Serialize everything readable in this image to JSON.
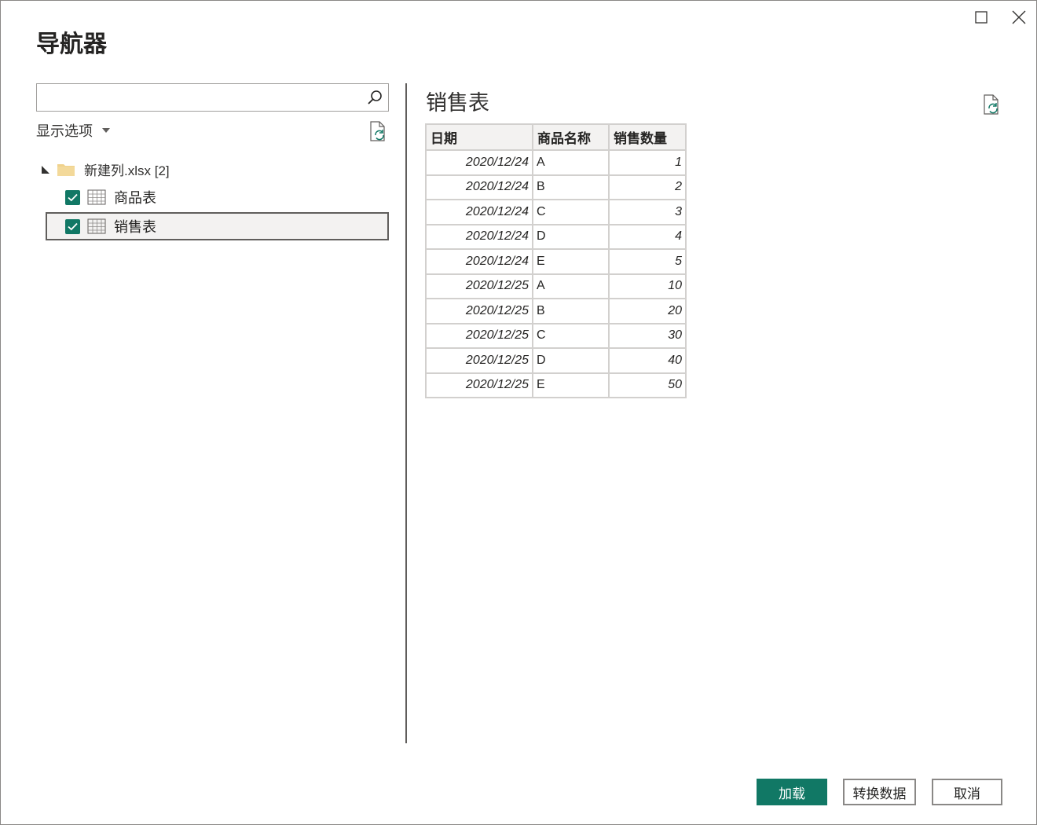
{
  "window": {
    "title": "导航器"
  },
  "left": {
    "search": {
      "value": "",
      "placeholder": ""
    },
    "options_label": "显示选项",
    "tree": {
      "root_label": "新建列.xlsx [2]",
      "items": [
        {
          "label": "商品表",
          "checked": true,
          "selected": false
        },
        {
          "label": "销售表",
          "checked": true,
          "selected": true
        }
      ]
    }
  },
  "preview": {
    "title": "销售表",
    "columns": [
      "日期",
      "商品名称",
      "销售数量"
    ],
    "rows": [
      [
        "2020/12/24",
        "A",
        "1"
      ],
      [
        "2020/12/24",
        "B",
        "2"
      ],
      [
        "2020/12/24",
        "C",
        "3"
      ],
      [
        "2020/12/24",
        "D",
        "4"
      ],
      [
        "2020/12/24",
        "E",
        "5"
      ],
      [
        "2020/12/25",
        "A",
        "10"
      ],
      [
        "2020/12/25",
        "B",
        "20"
      ],
      [
        "2020/12/25",
        "C",
        "30"
      ],
      [
        "2020/12/25",
        "D",
        "40"
      ],
      [
        "2020/12/25",
        "E",
        "50"
      ]
    ]
  },
  "buttons": {
    "load": "加载",
    "transform": "转换数据",
    "cancel": "取消"
  },
  "colors": {
    "accent": "#117865",
    "border": "#8a8886"
  }
}
